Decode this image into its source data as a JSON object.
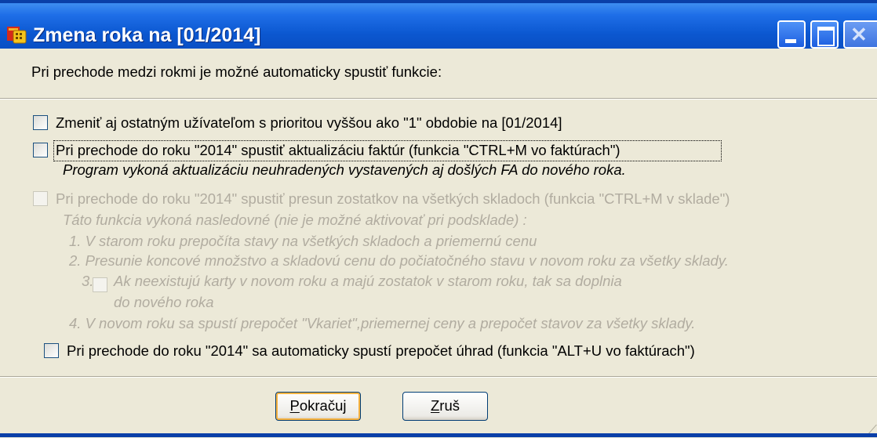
{
  "window": {
    "title": "Zmena roka na [01/2014]",
    "minimize_icon": "minimize-icon",
    "maximize_icon": "maximize-icon",
    "close_icon": "close-icon"
  },
  "intro": "Pri prechode medzi rokmi je možné automaticky spustiť funkcie:",
  "option1": {
    "label": "Zmeniť aj ostatným užívateľom s prioritou vyššou ako \"1\" obdobie na [01/2014]",
    "checked": false
  },
  "option2": {
    "label": "Pri prechode do roku \"2014\" spustiť aktualizáciu faktúr (funkcia \"CTRL+M vo faktúrach\")",
    "note": "Program vykoná aktualizáciu neuhradených vystavených aj došlých FA do nového roka.",
    "checked": false
  },
  "option3": {
    "label": "Pri prechode do roku \"2014\" spustiť presun zostatkov na všetkých skladoch (funkcia \"CTRL+M v sklade\")",
    "desc": "Táto funkcia vykoná nasledovné (nie je možné aktivovať pri podsklade) :",
    "step1": "1. V starom roku prepočíta stavy na všetkých skladoch a priemernú cenu",
    "step2": "2. Presunie koncové množstvo a skladovú cenu do počiatočného stavu v novom roku za všetky sklady.",
    "step3_num": "3.",
    "step3_a": "Ak neexistujú karty v novom roku a majú zostatok v starom roku, tak sa doplnia",
    "step3_b": "do nového roka",
    "step4": "4. V novom roku sa spustí prepočet \"Vkariet\",priemernej ceny a  prepočet stavov  za všetky sklady.",
    "checked": false,
    "disabled": true
  },
  "option4": {
    "label": "Pri prechode do roku \"2014\" sa automaticky spustí prepočet úhrad (funkcia \"ALT+U vo faktúrach\")",
    "checked": false
  },
  "buttons": {
    "continue_hotkey": "P",
    "continue_rest": "okračuj",
    "cancel_hotkey": "Z",
    "cancel_rest": "ruš"
  },
  "colors": {
    "titlebar": "#0b57d0",
    "dialog_bg": "#ece9d8",
    "disabled_text": "#b1aca0"
  }
}
